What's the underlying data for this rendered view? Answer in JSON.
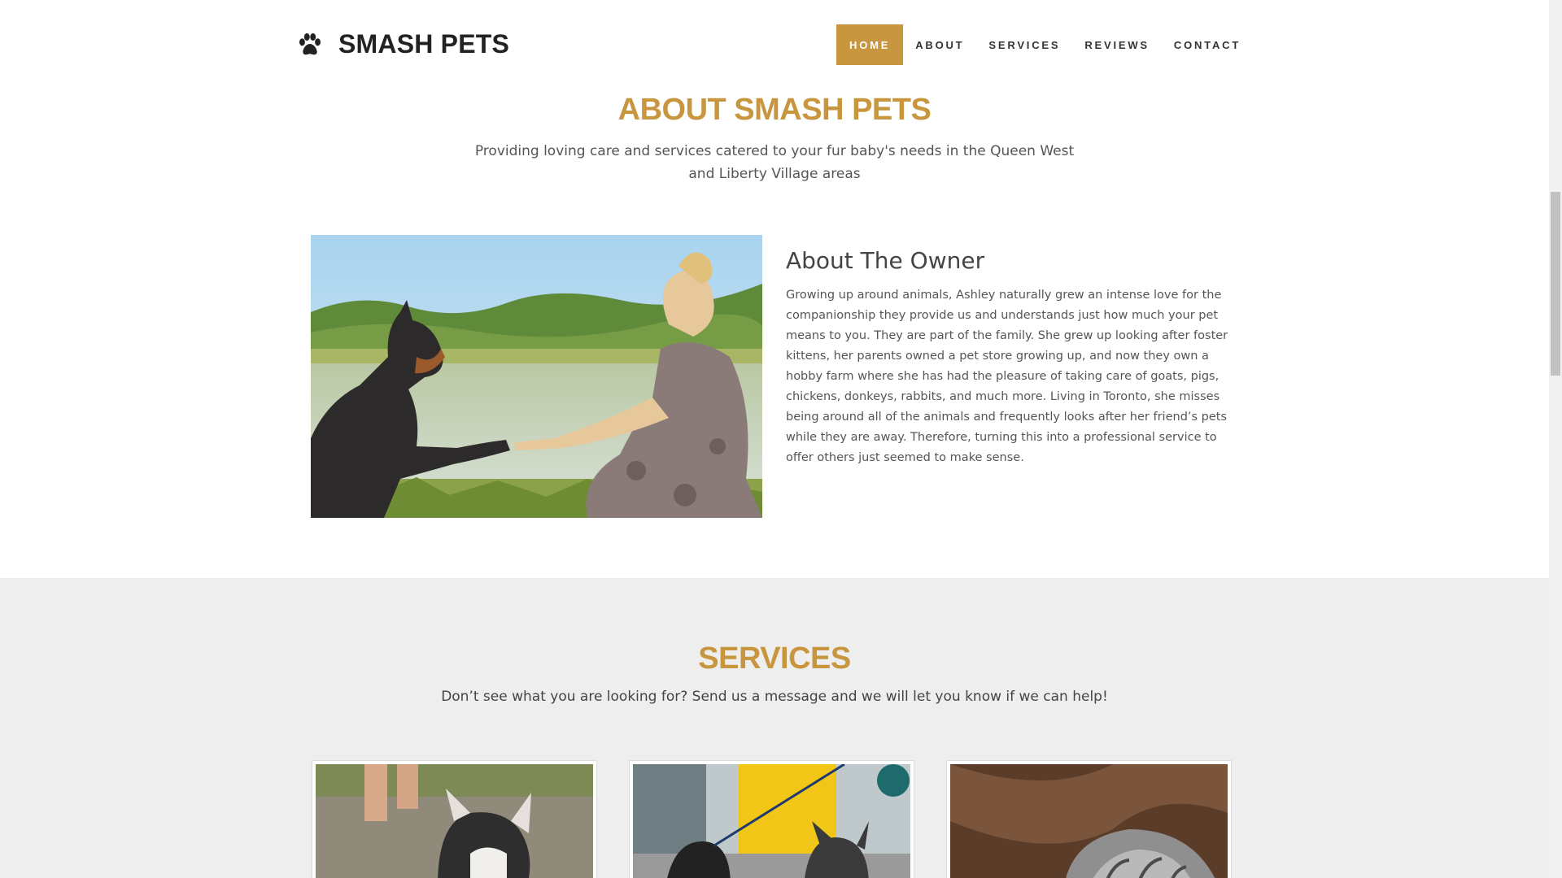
{
  "brand": {
    "name": "SMASH PETS",
    "icon": "paw-icon"
  },
  "nav": {
    "items": [
      {
        "label": "HOME",
        "active": true
      },
      {
        "label": "ABOUT",
        "active": false
      },
      {
        "label": "SERVICES",
        "active": false
      },
      {
        "label": "REVIEWS",
        "active": false
      },
      {
        "label": "CONTACT",
        "active": false
      }
    ]
  },
  "about": {
    "title": "ABOUT SMASH PETS",
    "subtitle": "Providing loving care and services catered to your fur baby's needs in the Queen West and Liberty Village areas",
    "image": "owner-with-doberman-photo",
    "owner_title": "About The Owner",
    "owner_text": "Growing up around animals, Ashley naturally grew an intense love for the companionship they provide us and understands just how much your pet means to you. They are part of the family. She grew up looking after foster kittens, her parents owned a pet store growing up, and now they own a hobby farm where she has had the pleasure of taking care of goats, pigs, chickens, donkeys, rabbits, and much more. Living in Toronto, she misses being around all of the animals and frequently looks after her friend’s pets while they are away. Therefore, turning this into a professional service to offer others just seemed to make sense."
  },
  "services": {
    "title": "SERVICES",
    "subtitle": "Don’t see what you are looking for? Send us a message and we will let you know if we can help!",
    "cards": [
      {
        "image": "dog-walking-photo"
      },
      {
        "image": "dogs-on-leash-photo"
      },
      {
        "image": "cat-sleeping-photo"
      }
    ]
  },
  "colors": {
    "accent": "#c8963e",
    "services_bg": "#eeeeee",
    "text": "#555555"
  }
}
